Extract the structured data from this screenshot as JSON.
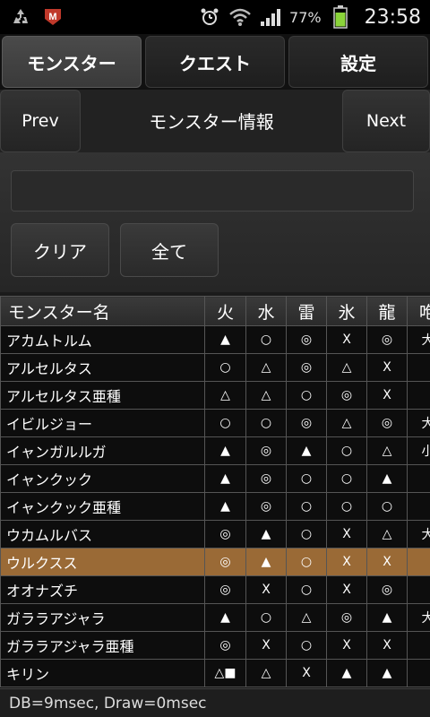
{
  "status_bar": {
    "left_icons": [
      "recycle-icon",
      "mcafee-icon"
    ],
    "battery_percent": "77%",
    "time": "23:58"
  },
  "tabs": [
    {
      "label": "モンスター",
      "active": true
    },
    {
      "label": "クエスト",
      "active": false
    },
    {
      "label": "設定",
      "active": false
    }
  ],
  "nav": {
    "prev": "Prev",
    "title": "モンスター情報",
    "next": "Next"
  },
  "search": {
    "value": "",
    "placeholder": "",
    "clear_label": "クリア",
    "all_label": "全て"
  },
  "table": {
    "headers": [
      "モンスター名",
      "火",
      "水",
      "雷",
      "氷",
      "龍",
      "咆"
    ],
    "rows": [
      {
        "name": "アカムトルム",
        "cells": [
          "▲",
          "○",
          "◎",
          "X",
          "◎",
          "大"
        ]
      },
      {
        "name": "アルセルタス",
        "cells": [
          "○",
          "△",
          "◎",
          "△",
          "X",
          ""
        ]
      },
      {
        "name": "アルセルタス亜種",
        "cells": [
          "△",
          "△",
          "○",
          "◎",
          "X",
          ""
        ]
      },
      {
        "name": "イビルジョー",
        "cells": [
          "○",
          "○",
          "◎",
          "△",
          "◎",
          "大"
        ]
      },
      {
        "name": "イャンガルルガ",
        "cells": [
          "▲",
          "◎",
          "▲",
          "○",
          "△",
          "小"
        ]
      },
      {
        "name": "イャンクック",
        "cells": [
          "▲",
          "◎",
          "○",
          "○",
          "▲",
          ""
        ]
      },
      {
        "name": "イャンクック亜種",
        "cells": [
          "▲",
          "◎",
          "○",
          "○",
          "○",
          ""
        ]
      },
      {
        "name": "ウカムルバス",
        "cells": [
          "◎",
          "▲",
          "○",
          "X",
          "△",
          "大"
        ]
      },
      {
        "name": "ウルクスス",
        "cells": [
          "◎",
          "▲",
          "○",
          "X",
          "X",
          ""
        ],
        "selected": true
      },
      {
        "name": "オオナズチ",
        "cells": [
          "◎",
          "X",
          "○",
          "X",
          "◎",
          ""
        ]
      },
      {
        "name": "ガララアジャラ",
        "cells": [
          "▲",
          "○",
          "△",
          "◎",
          "▲",
          "大"
        ]
      },
      {
        "name": "ガララアジャラ亜種",
        "cells": [
          "◎",
          "X",
          "○",
          "X",
          "X",
          ""
        ]
      },
      {
        "name": "キリン",
        "cells": [
          "△■",
          "△",
          "X",
          "▲",
          "▲",
          ""
        ]
      }
    ]
  },
  "footer": {
    "text": "DB=9msec, Draw=0msec"
  },
  "colors": {
    "selected_row": "#9a6a36"
  }
}
